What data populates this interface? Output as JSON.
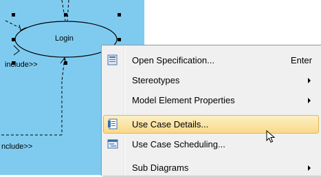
{
  "diagram": {
    "use_case": "Login",
    "include_label_1": "include>>",
    "include_label_2": "nclude>>"
  },
  "context_menu": {
    "items": [
      {
        "label": "Open Specification...",
        "shortcut": "Enter",
        "icon": "specification-icon",
        "submenu": false
      },
      {
        "label": "Stereotypes",
        "shortcut": "",
        "icon": "",
        "submenu": true
      },
      {
        "label": "Model Element Properties",
        "shortcut": "",
        "icon": "",
        "submenu": true
      },
      {
        "label": "Use Case Details...",
        "shortcut": "",
        "icon": "use-case-details-icon",
        "submenu": false,
        "highlighted": true
      },
      {
        "label": "Use Case Scheduling...",
        "shortcut": "",
        "icon": "scheduling-icon",
        "submenu": false
      },
      {
        "label": "Sub Diagrams",
        "shortcut": "",
        "icon": "",
        "submenu": true
      }
    ]
  },
  "colors": {
    "canvas": "#7fcbf0",
    "highlight": "#f9d98a",
    "menu_background": "#f0f0f0"
  }
}
